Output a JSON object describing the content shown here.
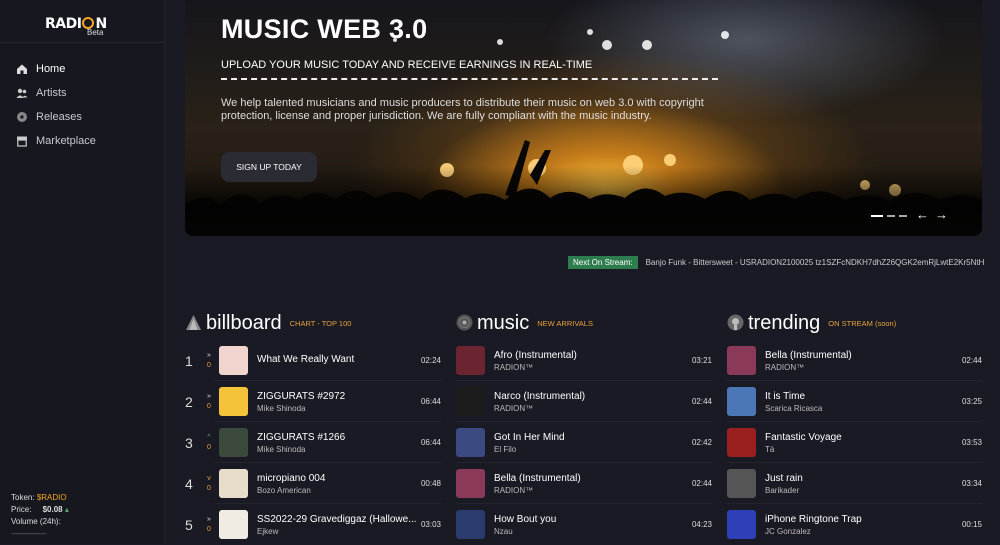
{
  "brand": {
    "name": "RADION",
    "badge": "Beta"
  },
  "nav": [
    {
      "label": "Home",
      "icon": "home-icon",
      "active": true
    },
    {
      "label": "Artists",
      "icon": "artists-icon"
    },
    {
      "label": "Releases",
      "icon": "disc-icon"
    },
    {
      "label": "Marketplace",
      "icon": "store-icon"
    }
  ],
  "token": {
    "label": "Token:",
    "symbol": "$RADIO",
    "price_label": "Price:",
    "price": "$0.08",
    "volume_label": "Volume (24h):",
    "volume": "---------------------"
  },
  "hero": {
    "title": "MUSIC WEB 3.0",
    "subtitle": "UPLOAD YOUR MUSIC TODAY AND RECEIVE EARNINGS IN REAL-TIME",
    "description": "We help talented musicians and music producers to distribute their music on web 3.0 with copyright protection, license and proper jurisdiction. We are fully compliant with the music industry.",
    "cta": "SIGN UP TODAY",
    "prev_arrow": "←",
    "next_arrow": "→"
  },
  "ticker": {
    "label": "Next On Stream:",
    "text": "Banjo Funk - Bittersweet - USRADION2100025 tz1SZFcNDKH7dhZ26QGK2emRjLwtE2Kr5NtH"
  },
  "columns": {
    "billboard": {
      "title": "billboard",
      "tag": "CHART - TOP 100",
      "icon": "billboard-icon",
      "rows": [
        {
          "rank": "1",
          "change_icon": "»",
          "change": "0",
          "title": "What We Really Want",
          "artist": "",
          "duration": "02:24",
          "color": "#f2d4cf"
        },
        {
          "rank": "2",
          "change_icon": "»",
          "change": "0",
          "title": "ZIGGURATS #2972",
          "artist": "Mike Shinoda",
          "duration": "06:44",
          "color": "#f4c33a"
        },
        {
          "rank": "3",
          "change_icon": "^",
          "change": "0",
          "title": "ZIGGURATS #1266",
          "artist": "Mike Shinoda",
          "duration": "06:44",
          "color": "#3b4a3d"
        },
        {
          "rank": "4",
          "change_icon": "v",
          "change": "0",
          "title": "micropiano 004",
          "artist": "Bozo American",
          "duration": "00:48",
          "color": "#e8dcca"
        },
        {
          "rank": "5",
          "change_icon": "»",
          "change": "0",
          "title": "SS2022-29 Gravediggaz (Hallowe...",
          "artist": "Ejkew",
          "duration": "03:03",
          "color": "#f0ece4"
        }
      ]
    },
    "music": {
      "title": "music",
      "tag": "NEW ARRIVALS",
      "icon": "vinyl-icon",
      "rows": [
        {
          "title": "Afro (Instrumental)",
          "artist": "RADION™",
          "duration": "03:21",
          "color": "#6b2430"
        },
        {
          "title": "Narco (Instrumental)",
          "artist": "RADION™",
          "duration": "02:44",
          "color": "#1c1c1c"
        },
        {
          "title": "Got In Her Mind",
          "artist": "El Filo",
          "duration": "02:42",
          "color": "#3c4a82"
        },
        {
          "title": "Bella (Instrumental)",
          "artist": "RADION™",
          "duration": "02:44",
          "color": "#8a3a58"
        },
        {
          "title": "How Bout you",
          "artist": "Nzau",
          "duration": "04:23",
          "color": "#2a3b6e"
        }
      ]
    },
    "trending": {
      "title": "trending",
      "tag": "ON STREAM (soon)",
      "icon": "radio-icon",
      "rows": [
        {
          "title": "Bella (Instrumental)",
          "artist": "RADION™",
          "duration": "02:44",
          "color": "#8a3a58"
        },
        {
          "title": "It is Time",
          "artist": "Scarica Ricasca",
          "duration": "03:25",
          "color": "#4c77b6"
        },
        {
          "title": "Fantastic Voyage",
          "artist": "Tá",
          "duration": "03:53",
          "color": "#9a1f1f"
        },
        {
          "title": "Just rain",
          "artist": "Barikader",
          "duration": "03:34",
          "color": "#555"
        },
        {
          "title": "iPhone Ringtone Trap",
          "artist": "JC Gonzalez",
          "duration": "00:15",
          "color": "#2f3fb8"
        }
      ]
    }
  }
}
